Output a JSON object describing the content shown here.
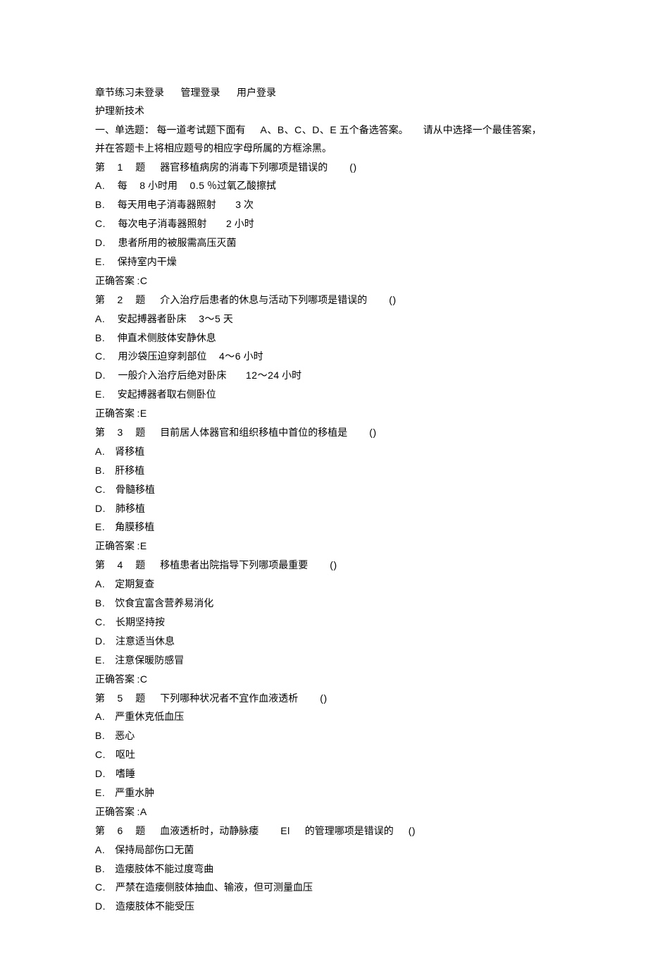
{
  "header": {
    "practice_not_logged": "章节练习未登录",
    "admin_login": "管理登录",
    "user_login": "用户登录"
  },
  "title": "护理新技术",
  "section_intro": {
    "label": "一、单选题：",
    "desc_part1": "每一道考试题下面有",
    "choices_letters": "A、B、C、D、E",
    "desc_part2": "五个备选答案。",
    "desc_part3": "请从中选择一个最佳答案，",
    "desc_line2": "并在答题卡上将相应题号的相应字母所属的方框涂黑。"
  },
  "questions": [
    {
      "num_prefix": "第",
      "num": "1",
      "num_suffix": "题",
      "stem": "器官移植病房的消毒下列哪项是错误的",
      "paren": "()",
      "options": [
        {
          "letter": "A.",
          "text_pre": "每",
          "num1": "8",
          "text_mid": "小时用",
          "num2": "0.5",
          "text_post": "％过氧乙酸擦拭"
        },
        {
          "letter": "B.",
          "text": "每天用电子消毒器照射",
          "num": "3",
          "text_post": "次"
        },
        {
          "letter": "C.",
          "text": "每次电子消毒器照射",
          "num": "2",
          "text_post": "小时"
        },
        {
          "letter": "D.",
          "text": "患者所用的被服需高压灭菌"
        },
        {
          "letter": "E.",
          "text": "保持室内干燥"
        }
      ],
      "answer_label": "正确答案",
      "answer": ":C"
    },
    {
      "num_prefix": "第",
      "num": "2",
      "num_suffix": "题",
      "stem": "介入治疗后患者的休息与活动下列哪项是错误的",
      "paren": "()",
      "options": [
        {
          "letter": "A.",
          "text": "安起搏器者卧床",
          "num": "3～5",
          "text_post": "天"
        },
        {
          "letter": "B.",
          "text": "伸直术侧肢体安静休息"
        },
        {
          "letter": "C.",
          "text": "用沙袋压迫穿刺部位",
          "num": "4～6",
          "text_post": "小时"
        },
        {
          "letter": "D.",
          "text": "一般介入治疗后绝对卧床",
          "num": "12～24",
          "text_post": "小时"
        },
        {
          "letter": "E.",
          "text": "安起搏器者取右侧卧位"
        }
      ],
      "answer_label": "正确答案",
      "answer": ":E"
    },
    {
      "num_prefix": "第",
      "num": "3",
      "num_suffix": "题",
      "stem": "目前居人体器官和组织移植中首位的移植是",
      "paren": "()",
      "options": [
        {
          "letter": "A.",
          "text": "肾移植"
        },
        {
          "letter": "B.",
          "text": "肝移植"
        },
        {
          "letter": "C.",
          "text": "骨髓移植"
        },
        {
          "letter": "D.",
          "text": "肺移植"
        },
        {
          "letter": "E.",
          "text": "角膜移植"
        }
      ],
      "answer_label": "正确答案",
      "answer": ":E"
    },
    {
      "num_prefix": "第",
      "num": "4",
      "num_suffix": "题",
      "stem": "移植患者出院指导下列哪项最重要",
      "paren": "()",
      "options": [
        {
          "letter": "A.",
          "text": "定期复查"
        },
        {
          "letter": "B.",
          "text": "饮食宜富含营养易消化"
        },
        {
          "letter": "C.",
          "text": "长期坚持按"
        },
        {
          "letter": "D.",
          "text": "注意适当休息"
        },
        {
          "letter": "E.",
          "text": "注意保暖防感冒"
        }
      ],
      "answer_label": "正确答案",
      "answer": ":C"
    },
    {
      "num_prefix": "第",
      "num": "5",
      "num_suffix": "题",
      "stem": "下列哪种状况者不宜作血液透析",
      "paren": "()",
      "options": [
        {
          "letter": "A.",
          "text": "严重休克低血压"
        },
        {
          "letter": "B.",
          "text": "恶心"
        },
        {
          "letter": "C.",
          "text": "呕吐"
        },
        {
          "letter": "D.",
          "text": "嗜睡"
        },
        {
          "letter": "E.",
          "text": "严重水肿"
        }
      ],
      "answer_label": "正确答案",
      "answer": ":A"
    },
    {
      "num_prefix": "第",
      "num": "6",
      "num_suffix": "题",
      "stem_part1": "血液透析时，动静脉瘘",
      "stem_latin": "El",
      "stem_part2": "的管理哪项是错误的",
      "paren": "()",
      "options": [
        {
          "letter": "A.",
          "text": "保持局部伤口无菌"
        },
        {
          "letter": "B.",
          "text": "造瘘肢体不能过度弯曲"
        },
        {
          "letter": "C.",
          "text": "严禁在造瘘侧肢体抽血、输液，但可测量血压"
        },
        {
          "letter": "D.",
          "text": "造瘘肢体不能受压"
        }
      ]
    }
  ]
}
